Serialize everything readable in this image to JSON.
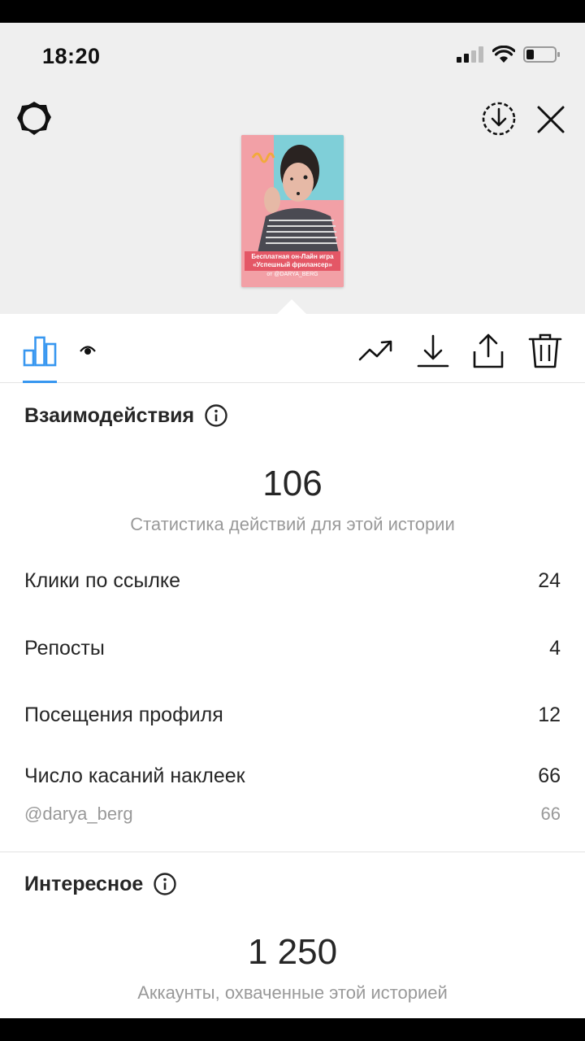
{
  "status_bar": {
    "time": "18:20"
  },
  "story_preview": {
    "caption_line1": "Бесплатная он-Лайн игра",
    "caption_line2": "«Успешный фрилансер»",
    "caption_line3": "от @DARYA_BERG"
  },
  "interactions": {
    "title": "Взаимодействия",
    "total": "106",
    "total_caption": "Статистика действий для этой истории",
    "rows": [
      {
        "label": "Клики по ссылке",
        "value": "24"
      },
      {
        "label": "Репосты",
        "value": "4"
      },
      {
        "label": "Посещения профиля",
        "value": "12"
      },
      {
        "label": "Число касаний наклеек",
        "value": "66"
      }
    ],
    "sticker_detail": {
      "label": "@darya_berg",
      "value": "66"
    }
  },
  "discovery": {
    "title": "Интересное",
    "total": "1 250",
    "total_caption": "Аккаунты, охваченные этой историей"
  },
  "colors": {
    "accent": "#3897f0",
    "panel_gray": "#efefef",
    "text": "#262626",
    "secondary_text": "#999999"
  },
  "icons": [
    "settings-gear-icon",
    "download-circle-icon",
    "close-icon",
    "bar-chart-icon",
    "eye-icon",
    "trending-up-icon",
    "download-icon",
    "share-icon",
    "trash-icon",
    "info-icon"
  ]
}
